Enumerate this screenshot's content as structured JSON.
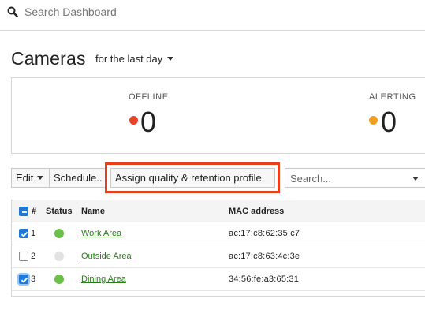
{
  "search": {
    "placeholder": "Search Dashboard"
  },
  "header": {
    "title": "Cameras",
    "timespan": "for the last day"
  },
  "stats": [
    {
      "label": "OFFLINE",
      "value": "0",
      "color": "#e8442b"
    },
    {
      "label": "ALERTING",
      "value": "0",
      "color": "#f0a020"
    }
  ],
  "toolbar": {
    "edit_label": "Edit",
    "schedule_label": "Schedule..",
    "assign_label": "Assign quality & retention profile",
    "search_placeholder": "Search..."
  },
  "table": {
    "columns": {
      "num": "#",
      "status": "Status",
      "name": "Name",
      "mac": "MAC address"
    },
    "rows": [
      {
        "num": "1",
        "name": "Work Area",
        "mac": "ac:17:c8:62:35:c7",
        "selected": true,
        "status": "online"
      },
      {
        "num": "2",
        "name": "Outside Area",
        "mac": "ac:17:c8:63:4c:3e",
        "selected": false,
        "status": "unknown"
      },
      {
        "num": "3",
        "name": "Dining Area",
        "mac": "34:56:fe:a3:65:31",
        "selected": true,
        "status": "online"
      }
    ]
  },
  "colors": {
    "status_online": "#6cc04a",
    "status_unknown": "#e2e2e2",
    "highlight": "#e8401c",
    "checkbox": "#1e78d8",
    "link": "#2d7a1f"
  }
}
